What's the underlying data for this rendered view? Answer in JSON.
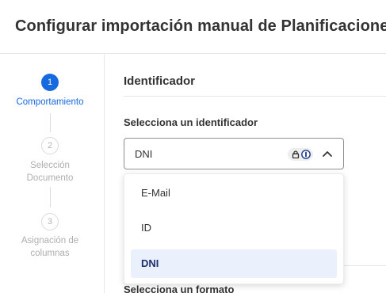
{
  "header": {
    "title": "Configurar importación manual de Planificaciones"
  },
  "stepper": {
    "steps": [
      {
        "number": "1",
        "label": "Comportamiento",
        "state": "active"
      },
      {
        "number": "2",
        "label": "Selección Documento",
        "state": "inactive"
      },
      {
        "number": "3",
        "label": "Asignación de columnas",
        "state": "inactive"
      }
    ]
  },
  "main": {
    "section_title": "Identificador",
    "identifier_field": {
      "label": "Selecciona un identificador",
      "selected_value": "DNI",
      "expanded": true,
      "options": [
        {
          "label": "E-Mail",
          "selected": false
        },
        {
          "label": "ID",
          "selected": false
        },
        {
          "label": "DNI",
          "selected": true
        }
      ]
    },
    "format_field": {
      "label": "Selecciona un formato"
    }
  },
  "colors": {
    "accent": "#1769e0",
    "selected_option_bg": "#eaf1fd",
    "border": "#e6e6e6"
  },
  "icons": {
    "select_badge": [
      "lock-icon",
      "keyhole-icon"
    ],
    "select_toggle": "chevron-up-icon"
  }
}
